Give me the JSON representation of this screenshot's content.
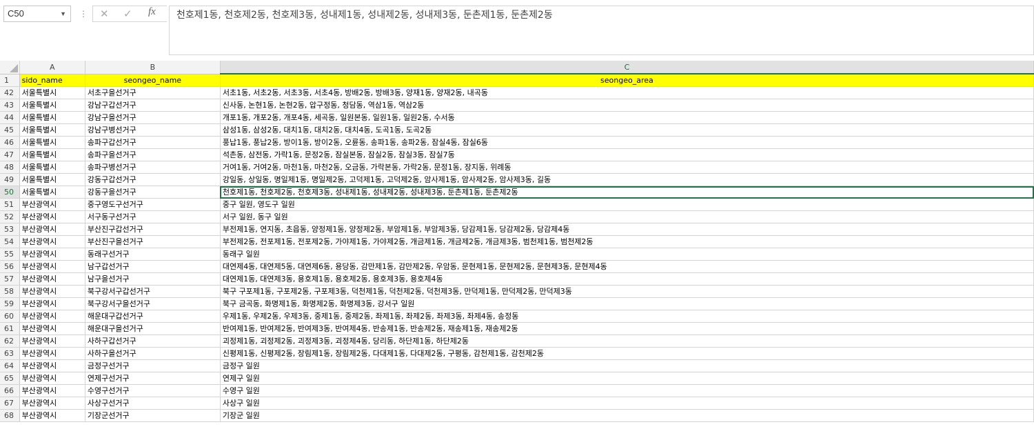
{
  "name_box": "C50",
  "formula_text": "천호제1동, 천호제2동, 천호제3동, 성내제1동, 성내제2동, 성내제3동, 둔촌제1동, 둔촌제2동",
  "columns": [
    "A",
    "B",
    "C"
  ],
  "header_row": {
    "num": "1",
    "a": "sido_name",
    "b": "seongeo_name",
    "c": "seongeo_area"
  },
  "rows": [
    {
      "num": "42",
      "a": "서울특별시",
      "b": "서초구을선거구",
      "c": "서초1동, 서초2동, 서초3동, 서초4동, 방배2동, 방배3동, 양재1동, 양재2동, 내곡동"
    },
    {
      "num": "43",
      "a": "서울특별시",
      "b": "강남구갑선거구",
      "c": "신사동, 논현1동, 논현2동, 압구정동, 청담동, 역삼1동, 역삼2동"
    },
    {
      "num": "44",
      "a": "서울특별시",
      "b": "강남구을선거구",
      "c": "개포1동, 개포2동, 개포4동, 세곡동, 일원본동, 일원1동, 일원2동, 수서동"
    },
    {
      "num": "45",
      "a": "서울특별시",
      "b": "강남구병선거구",
      "c": "삼성1동, 삼성2동, 대치1동, 대치2동, 대치4동, 도곡1동, 도곡2동"
    },
    {
      "num": "46",
      "a": "서울특별시",
      "b": "송파구갑선거구",
      "c": "풍납1동, 풍납2동, 방이1동, 방이2동, 오륜동, 송파1동, 송파2동, 잠실4동, 잠실6동"
    },
    {
      "num": "47",
      "a": "서울특별시",
      "b": "송파구을선거구",
      "c": "석촌동, 삼전동, 가락1동, 문정2동, 잠실본동, 잠실2동, 잠실3동, 잠실7동"
    },
    {
      "num": "48",
      "a": "서울특별시",
      "b": "송파구병선거구",
      "c": "거여1동, 거여2동, 마천1동, 마천2동, 오금동, 가락본동, 가락2동, 문정1동, 장지동, 위례동"
    },
    {
      "num": "49",
      "a": "서울특별시",
      "b": "강동구갑선거구",
      "c": "강일동, 상일동, 명일제1동, 명일제2동, 고덕제1동, 고덕제2동, 암사제1동, 암사제2동, 암사제3동, 길동"
    },
    {
      "num": "50",
      "a": "서울특별시",
      "b": "강동구을선거구",
      "c": "천호제1동, 천호제2동, 천호제3동, 성내제1동, 성내제2동, 성내제3동, 둔촌제1동, 둔촌제2동"
    },
    {
      "num": "51",
      "a": "부산광역시",
      "b": "중구영도구선거구",
      "c": "중구 일원, 영도구 일원"
    },
    {
      "num": "52",
      "a": "부산광역시",
      "b": "서구동구선거구",
      "c": "서구 일원, 동구 일원"
    },
    {
      "num": "53",
      "a": "부산광역시",
      "b": "부산진구갑선거구",
      "c": "부전제1동, 연지동, 초읍동, 양정제1동, 양정제2동, 부암제1동, 부암제3동, 당감제1동, 당감제2동, 당감제4동"
    },
    {
      "num": "54",
      "a": "부산광역시",
      "b": "부산진구을선거구",
      "c": "부전제2동, 전포제1동, 전포제2동, 가야제1동, 가야제2동, 개금제1동, 개금제2동, 개금제3동, 범천제1동, 범천제2동"
    },
    {
      "num": "55",
      "a": "부산광역시",
      "b": "동래구선거구",
      "c": "동래구 일원"
    },
    {
      "num": "56",
      "a": "부산광역시",
      "b": "남구갑선거구",
      "c": "대연제4동, 대연제5동, 대연제6동, 용당동, 감만제1동, 감만제2동, 우암동, 문현제1동, 문현제2동, 문현제3동, 문현제4동"
    },
    {
      "num": "57",
      "a": "부산광역시",
      "b": "남구을선거구",
      "c": "대연제1동, 대연제3동, 용호제1동, 용호제2동, 용호제3동, 용호제4동"
    },
    {
      "num": "58",
      "a": "부산광역시",
      "b": "북구강서구갑선거구",
      "c": "북구 구포제1동, 구포제2동, 구포제3동, 덕천제1동, 덕천제2동, 덕천제3동, 만덕제1동, 만덕제2동, 만덕제3동"
    },
    {
      "num": "59",
      "a": "부산광역시",
      "b": "북구강서구을선거구",
      "c": "북구 금곡동, 화명제1동, 화명제2동, 화명제3동, 강서구 일원"
    },
    {
      "num": "60",
      "a": "부산광역시",
      "b": "해운대구갑선거구",
      "c": "우제1동, 우제2동, 우제3동, 중제1동, 중제2동, 좌제1동, 좌제2동, 좌제3동, 좌제4동, 송정동"
    },
    {
      "num": "61",
      "a": "부산광역시",
      "b": "해운대구을선거구",
      "c": "반여제1동, 반여제2동, 반여제3동, 반여제4동, 반송제1동, 반송제2동, 재송제1동, 재송제2동"
    },
    {
      "num": "62",
      "a": "부산광역시",
      "b": "사하구갑선거구",
      "c": "괴정제1동, 괴정제2동, 괴정제3동, 괴정제4동, 당리동, 하단제1동, 하단제2동"
    },
    {
      "num": "63",
      "a": "부산광역시",
      "b": "사하구을선거구",
      "c": "신평제1동, 신평제2동, 장림제1동, 장림제2동, 다대제1동, 다대제2동, 구평동, 감천제1동, 감천제2동"
    },
    {
      "num": "64",
      "a": "부산광역시",
      "b": "금정구선거구",
      "c": "금정구 일원"
    },
    {
      "num": "65",
      "a": "부산광역시",
      "b": "연제구선거구",
      "c": "연제구 일원"
    },
    {
      "num": "66",
      "a": "부산광역시",
      "b": "수영구선거구",
      "c": "수영구 일원"
    },
    {
      "num": "67",
      "a": "부산광역시",
      "b": "사상구선거구",
      "c": "사상구 일원"
    },
    {
      "num": "68",
      "a": "부산광역시",
      "b": "기장군선거구",
      "c": "기장군 일원"
    }
  ]
}
